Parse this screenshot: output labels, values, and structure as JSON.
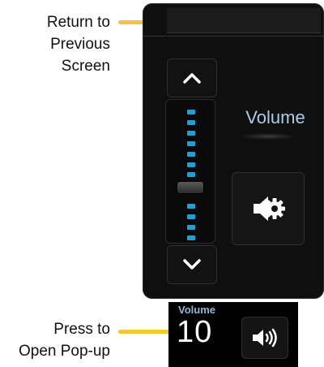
{
  "callouts": {
    "return_lines": [
      "Return to",
      "Previous",
      "Screen"
    ],
    "press_lines": [
      "Press to",
      "Open Pop-up"
    ]
  },
  "panel": {
    "volume_label": "Volume",
    "level_segments": 14
  },
  "bottom_strip": {
    "label": "Volume",
    "value": "10"
  },
  "icons": {
    "up": "chevron-up-icon",
    "down": "chevron-down-icon",
    "settings": "speaker-settings-icon",
    "speaker": "speaker-volume-icon"
  },
  "colors": {
    "accent_yellow": "#f3c63a",
    "level_blue": "#1ea0d6",
    "label_blue": "#a7cee6"
  }
}
